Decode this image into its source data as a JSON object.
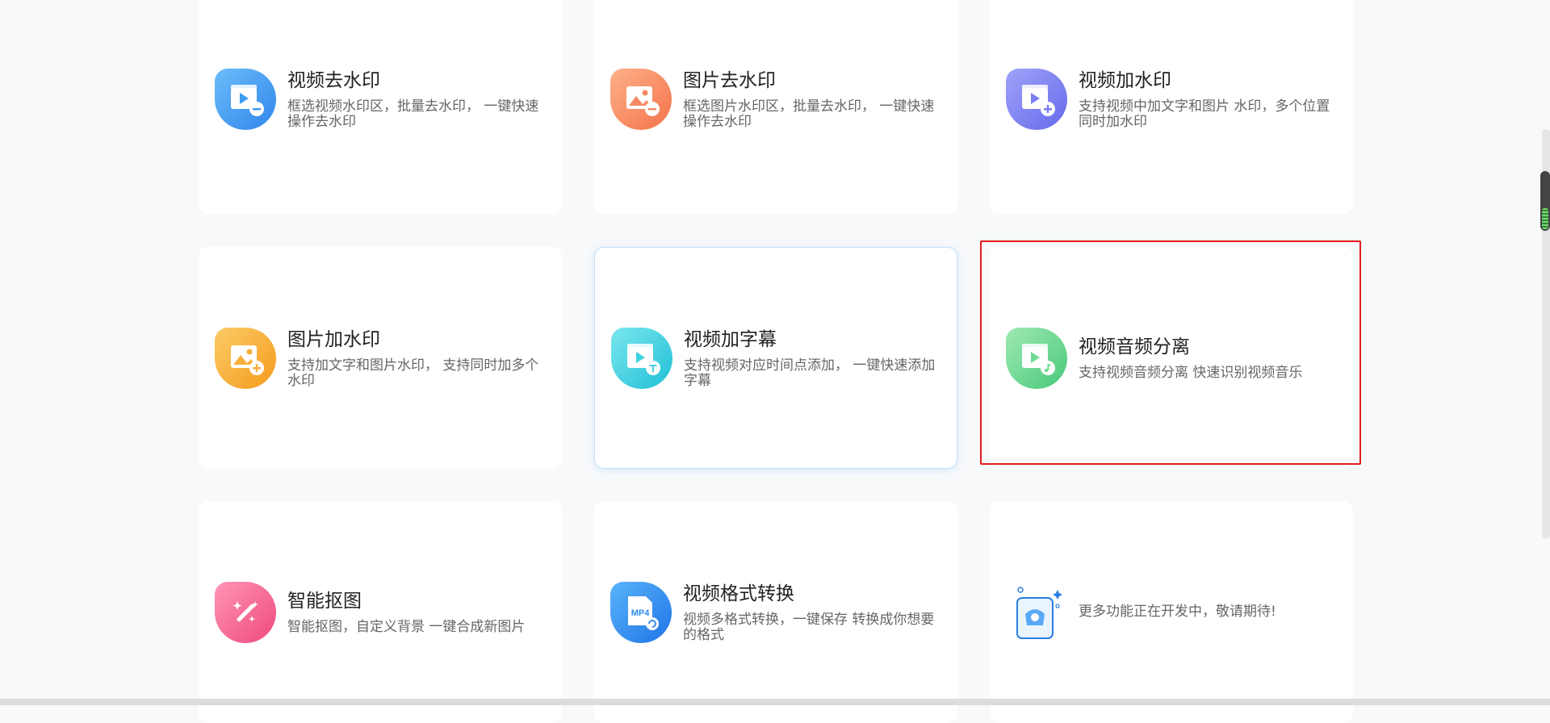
{
  "cards": [
    {
      "title": "视频去水印",
      "desc": "框选视频水印区，批量去水印， 一键快速操作去水印",
      "icon": "video-remove-watermark-icon",
      "color": "#3f9bf0"
    },
    {
      "title": "图片去水印",
      "desc": "框选图片水印区，批量去水印， 一键快速操作去水印",
      "icon": "image-remove-watermark-icon",
      "color": "#f68a63"
    },
    {
      "title": "视频加水印",
      "desc": "支持视频中加文字和图片 水印，多个位置同时加水印",
      "icon": "video-add-watermark-icon",
      "color": "#7b7ff2"
    },
    {
      "title": "图片加水印",
      "desc": "支持加文字和图片水印， 支持同时加多个水印",
      "icon": "image-add-watermark-icon",
      "color": "#f7b03a"
    },
    {
      "title": "视频加字幕",
      "desc": "支持视频对应时间点添加， 一键快速添加字幕",
      "icon": "video-subtitle-icon",
      "color": "#3fd3e0"
    },
    {
      "title": "视频音频分离",
      "desc": "支持视频音频分离 快速识别视频音乐",
      "icon": "audio-separation-icon",
      "color": "#6fdb92"
    },
    {
      "title": "智能抠图",
      "desc": "智能抠图，自定义背景 一键合成新图片",
      "icon": "magic-wand-icon",
      "color": "#f5668f"
    },
    {
      "title": "视频格式转换",
      "desc": "视频多格式转换，一键保存 转换成你想要的格式",
      "icon": "mp4-convert-icon",
      "color": "#2f8cf0",
      "badge": "MP4"
    },
    {
      "title": "",
      "desc": "更多功能正在开发中，敬请期待!",
      "icon": "coming-soon-illustration-icon",
      "color": "#2a7de1"
    }
  ]
}
